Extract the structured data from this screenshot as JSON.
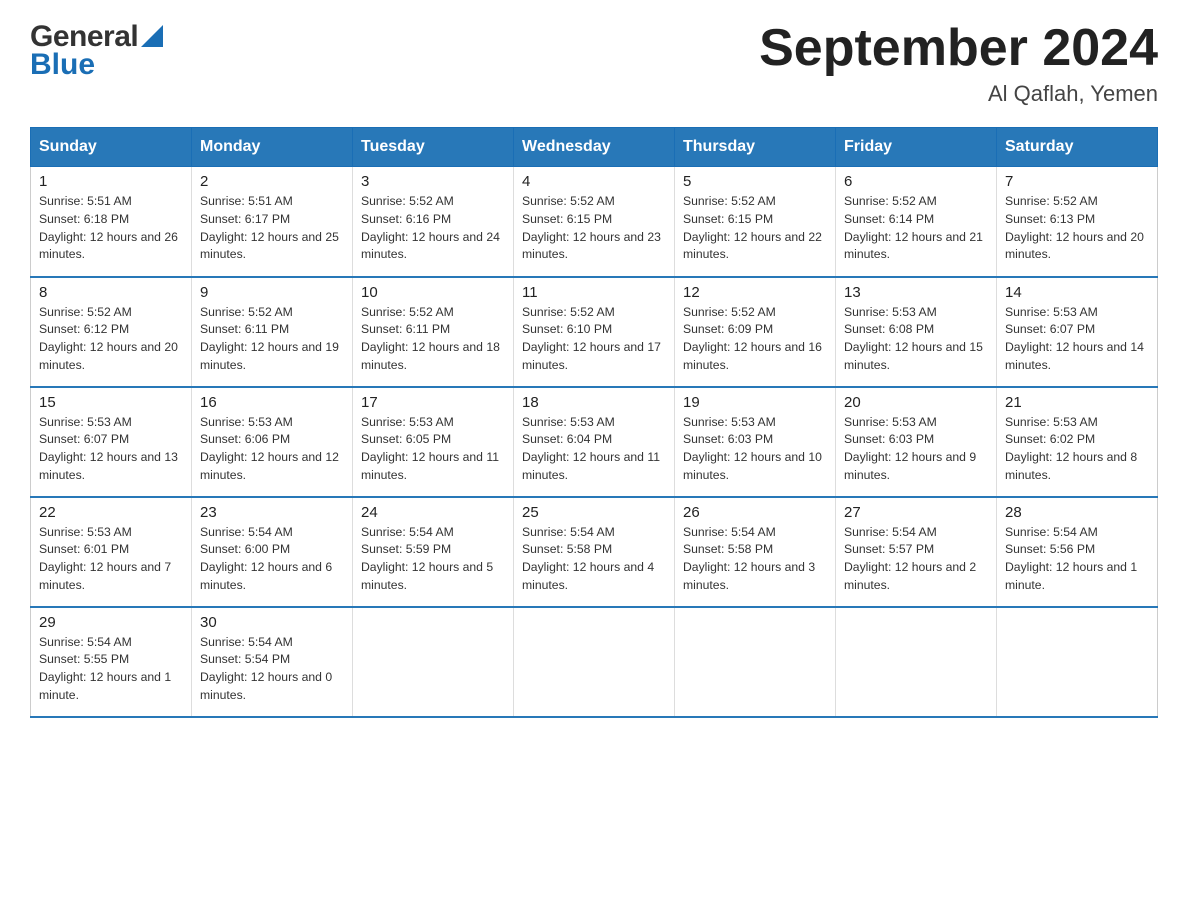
{
  "header": {
    "title": "September 2024",
    "subtitle": "Al Qaflah, Yemen"
  },
  "weekdays": [
    "Sunday",
    "Monday",
    "Tuesday",
    "Wednesday",
    "Thursday",
    "Friday",
    "Saturday"
  ],
  "weeks": [
    [
      {
        "day": "1",
        "sunrise": "5:51 AM",
        "sunset": "6:18 PM",
        "daylight": "12 hours and 26 minutes."
      },
      {
        "day": "2",
        "sunrise": "5:51 AM",
        "sunset": "6:17 PM",
        "daylight": "12 hours and 25 minutes."
      },
      {
        "day": "3",
        "sunrise": "5:52 AM",
        "sunset": "6:16 PM",
        "daylight": "12 hours and 24 minutes."
      },
      {
        "day": "4",
        "sunrise": "5:52 AM",
        "sunset": "6:15 PM",
        "daylight": "12 hours and 23 minutes."
      },
      {
        "day": "5",
        "sunrise": "5:52 AM",
        "sunset": "6:15 PM",
        "daylight": "12 hours and 22 minutes."
      },
      {
        "day": "6",
        "sunrise": "5:52 AM",
        "sunset": "6:14 PM",
        "daylight": "12 hours and 21 minutes."
      },
      {
        "day": "7",
        "sunrise": "5:52 AM",
        "sunset": "6:13 PM",
        "daylight": "12 hours and 20 minutes."
      }
    ],
    [
      {
        "day": "8",
        "sunrise": "5:52 AM",
        "sunset": "6:12 PM",
        "daylight": "12 hours and 20 minutes."
      },
      {
        "day": "9",
        "sunrise": "5:52 AM",
        "sunset": "6:11 PM",
        "daylight": "12 hours and 19 minutes."
      },
      {
        "day": "10",
        "sunrise": "5:52 AM",
        "sunset": "6:11 PM",
        "daylight": "12 hours and 18 minutes."
      },
      {
        "day": "11",
        "sunrise": "5:52 AM",
        "sunset": "6:10 PM",
        "daylight": "12 hours and 17 minutes."
      },
      {
        "day": "12",
        "sunrise": "5:52 AM",
        "sunset": "6:09 PM",
        "daylight": "12 hours and 16 minutes."
      },
      {
        "day": "13",
        "sunrise": "5:53 AM",
        "sunset": "6:08 PM",
        "daylight": "12 hours and 15 minutes."
      },
      {
        "day": "14",
        "sunrise": "5:53 AM",
        "sunset": "6:07 PM",
        "daylight": "12 hours and 14 minutes."
      }
    ],
    [
      {
        "day": "15",
        "sunrise": "5:53 AM",
        "sunset": "6:07 PM",
        "daylight": "12 hours and 13 minutes."
      },
      {
        "day": "16",
        "sunrise": "5:53 AM",
        "sunset": "6:06 PM",
        "daylight": "12 hours and 12 minutes."
      },
      {
        "day": "17",
        "sunrise": "5:53 AM",
        "sunset": "6:05 PM",
        "daylight": "12 hours and 11 minutes."
      },
      {
        "day": "18",
        "sunrise": "5:53 AM",
        "sunset": "6:04 PM",
        "daylight": "12 hours and 11 minutes."
      },
      {
        "day": "19",
        "sunrise": "5:53 AM",
        "sunset": "6:03 PM",
        "daylight": "12 hours and 10 minutes."
      },
      {
        "day": "20",
        "sunrise": "5:53 AM",
        "sunset": "6:03 PM",
        "daylight": "12 hours and 9 minutes."
      },
      {
        "day": "21",
        "sunrise": "5:53 AM",
        "sunset": "6:02 PM",
        "daylight": "12 hours and 8 minutes."
      }
    ],
    [
      {
        "day": "22",
        "sunrise": "5:53 AM",
        "sunset": "6:01 PM",
        "daylight": "12 hours and 7 minutes."
      },
      {
        "day": "23",
        "sunrise": "5:54 AM",
        "sunset": "6:00 PM",
        "daylight": "12 hours and 6 minutes."
      },
      {
        "day": "24",
        "sunrise": "5:54 AM",
        "sunset": "5:59 PM",
        "daylight": "12 hours and 5 minutes."
      },
      {
        "day": "25",
        "sunrise": "5:54 AM",
        "sunset": "5:58 PM",
        "daylight": "12 hours and 4 minutes."
      },
      {
        "day": "26",
        "sunrise": "5:54 AM",
        "sunset": "5:58 PM",
        "daylight": "12 hours and 3 minutes."
      },
      {
        "day": "27",
        "sunrise": "5:54 AM",
        "sunset": "5:57 PM",
        "daylight": "12 hours and 2 minutes."
      },
      {
        "day": "28",
        "sunrise": "5:54 AM",
        "sunset": "5:56 PM",
        "daylight": "12 hours and 1 minute."
      }
    ],
    [
      {
        "day": "29",
        "sunrise": "5:54 AM",
        "sunset": "5:55 PM",
        "daylight": "12 hours and 1 minute."
      },
      {
        "day": "30",
        "sunrise": "5:54 AM",
        "sunset": "5:54 PM",
        "daylight": "12 hours and 0 minutes."
      },
      null,
      null,
      null,
      null,
      null
    ]
  ]
}
